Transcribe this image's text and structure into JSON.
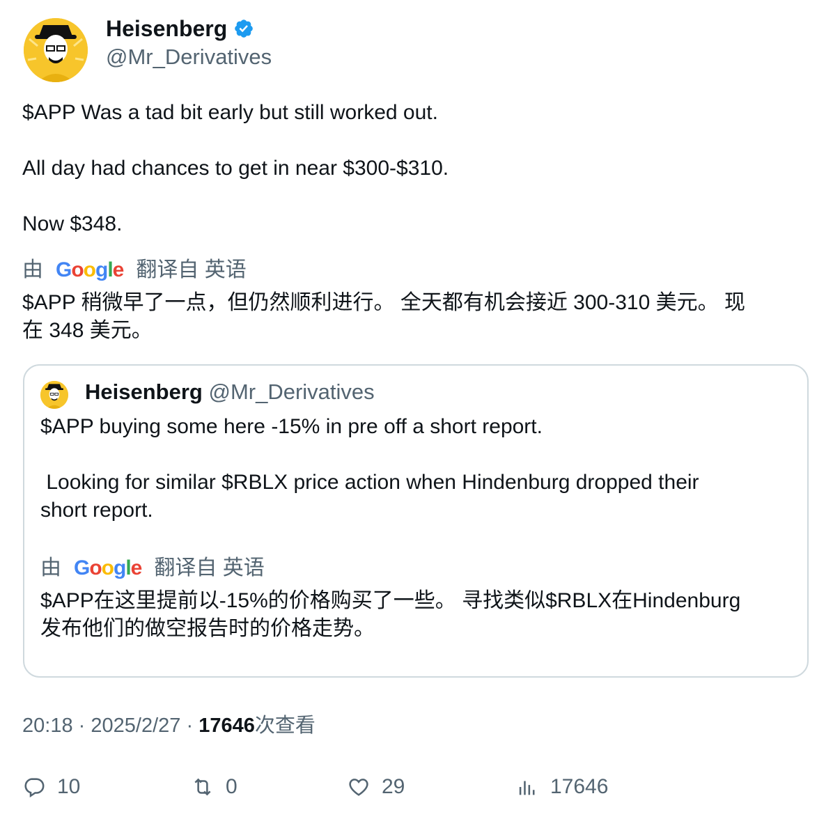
{
  "tweet": {
    "author_name": "Heisenberg",
    "author_handle": "@Mr_Derivatives",
    "lines": [
      "$APP Was a tad bit early but still worked out.",
      "All day had chances to get in near $300-$310.",
      "Now $348."
    ],
    "translate": {
      "prefix": "由",
      "logo_letters": [
        "G",
        "o",
        "o",
        "g",
        "l",
        "e"
      ],
      "suffix": "翻译自 英语",
      "text_line1": "$APP 稍微早了一点，但仍然顺利进行。 全天都有机会接近 300-310 美元。 现",
      "text_line2": "在 348 美元。"
    }
  },
  "quoted": {
    "author_name": "Heisenberg",
    "author_handle": "@Mr_Derivatives",
    "lines": [
      "$APP buying some here -15% in pre off a short report.",
      " Looking for similar $RBLX price action when Hindenburg dropped their",
      "short report."
    ],
    "translate": {
      "prefix": "由",
      "suffix": "翻译自 英语",
      "text_line1": "$APP在这里提前以-15%的价格购买了一些。 寻找类似$RBLX在Hindenburg",
      "text_line2": "发布他们的做空报告时的价格走势。"
    }
  },
  "meta": {
    "time": "20:18",
    "sep1": "·",
    "date": "2025/2/27",
    "sep2": "·",
    "views_count": "17646",
    "views_label": "次查看"
  },
  "actions": {
    "replies": "10",
    "retweets": "0",
    "likes": "29",
    "views": "17646"
  },
  "colors": {
    "verified": "#1d9bf0",
    "secondary_text": "#536471",
    "border": "#cfd9de",
    "avatar_bg": "#f7c52b"
  },
  "icons": [
    "verified-badge-icon",
    "reply-icon",
    "retweet-icon",
    "like-icon",
    "views-icon"
  ]
}
